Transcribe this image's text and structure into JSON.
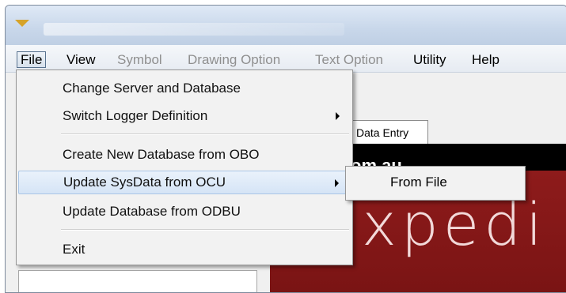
{
  "menubar": {
    "items": [
      {
        "label": "File",
        "state": "active"
      },
      {
        "label": "View",
        "state": "enabled"
      },
      {
        "label": "Symbol",
        "state": "disabled"
      },
      {
        "label": "Drawing Option",
        "state": "disabled"
      },
      {
        "label": "Text Option",
        "state": "disabled"
      },
      {
        "label": "Utility",
        "state": "enabled"
      },
      {
        "label": "Help",
        "state": "enabled"
      }
    ]
  },
  "file_menu": {
    "items": [
      {
        "label": "Change Server and Database",
        "has_submenu": false
      },
      {
        "label": "Switch Logger Definition",
        "has_submenu": true
      },
      {
        "label": "Create New Database from OBO",
        "has_submenu": false
      },
      {
        "label": "Update SysData from OCU",
        "has_submenu": true,
        "highlighted": true
      },
      {
        "label": "Update Database from ODBU",
        "has_submenu": false
      },
      {
        "label": "Exit",
        "has_submenu": false
      }
    ]
  },
  "submenu": {
    "items": [
      {
        "label": "From File"
      }
    ]
  },
  "content": {
    "tab_label": "Data Entry",
    "banner_text": "om.au",
    "brand_text": "xpedi"
  },
  "colors": {
    "banner_red": "#8e1b1b",
    "menu_highlight": "#d5e4f6"
  }
}
